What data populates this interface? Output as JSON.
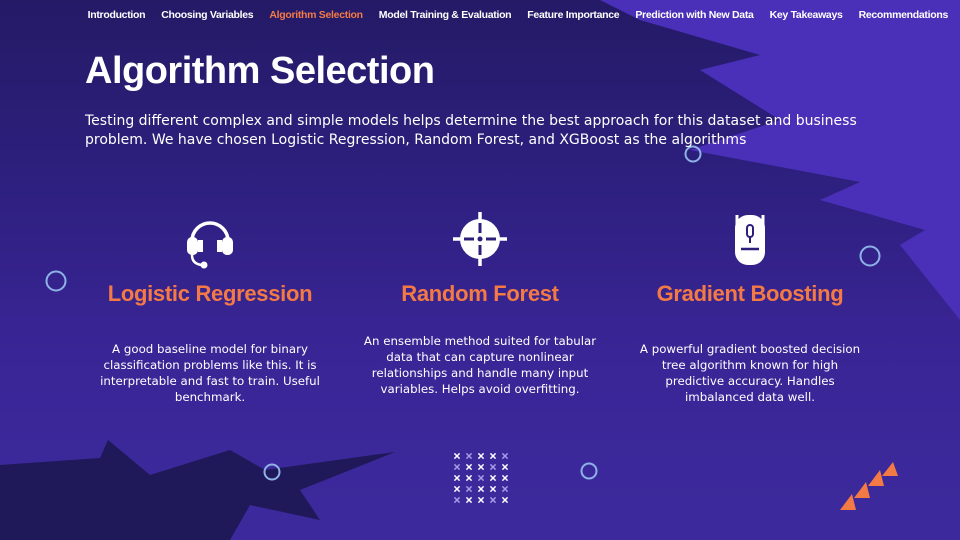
{
  "nav": {
    "items": [
      {
        "label": "Introduction"
      },
      {
        "label": "Choosing Variables"
      },
      {
        "label": "Algorithm Selection"
      },
      {
        "label": "Model Training & Evaluation"
      },
      {
        "label": "Feature Importance"
      },
      {
        "label": "Prediction with New Data"
      },
      {
        "label": "Key Takeaways"
      },
      {
        "label": "Recommendations"
      }
    ],
    "active_label": "Algorithm Selection"
  },
  "slide": {
    "title": "Algorithm Selection",
    "intro": "Testing different complex and simple models helps determine the best approach for this dataset and business problem. We have chosen Logistic Regression, Random Forest, and XGBoost as the algorithms"
  },
  "cards": [
    {
      "icon": "headset-icon",
      "title": "Logistic Regression",
      "text": "A good baseline model for binary classification problems like this. It is interpretable and fast to train. Useful benchmark."
    },
    {
      "icon": "crosshair-icon",
      "title": "Random Forest",
      "text": "An ensemble method suited for tabular data that can capture nonlinear relationships and handle many input variables. Helps avoid overfitting."
    },
    {
      "icon": "mouse-icon",
      "title": "Gradient Boosting",
      "text": "A powerful gradient boosted decision tree algorithm known for high predictive accuracy. Handles imbalanced data well."
    }
  ],
  "colors": {
    "accent": "#f47a45",
    "background": "#2c1f7c",
    "shape": "#4a2fb8",
    "ring": "#8fb2e6"
  }
}
